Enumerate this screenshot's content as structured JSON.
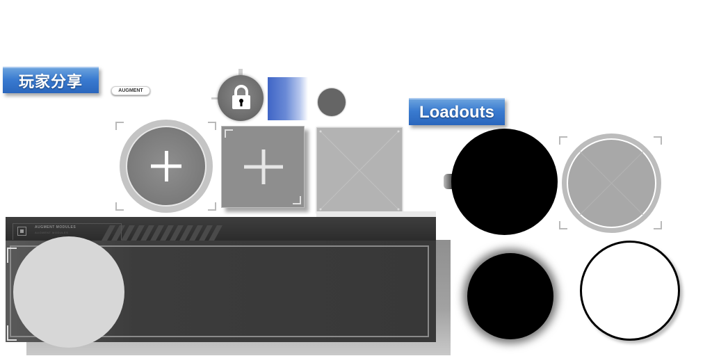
{
  "banners": {
    "player_share": "玩家分享",
    "loadouts": "Loadouts"
  },
  "augment_tag": "AUGMENT",
  "panel": {
    "title": "AUGMENT MODULES",
    "subtitle": "AUGMENT MODULES"
  },
  "icons": {
    "lock": "lock-icon",
    "add": "plus-icon",
    "placeholder": "cross-placeholder-icon"
  },
  "colors": {
    "banner_blue": "#3a7bd0",
    "panel_dark": "#383838",
    "slot_gray": "#8e8e8e"
  }
}
